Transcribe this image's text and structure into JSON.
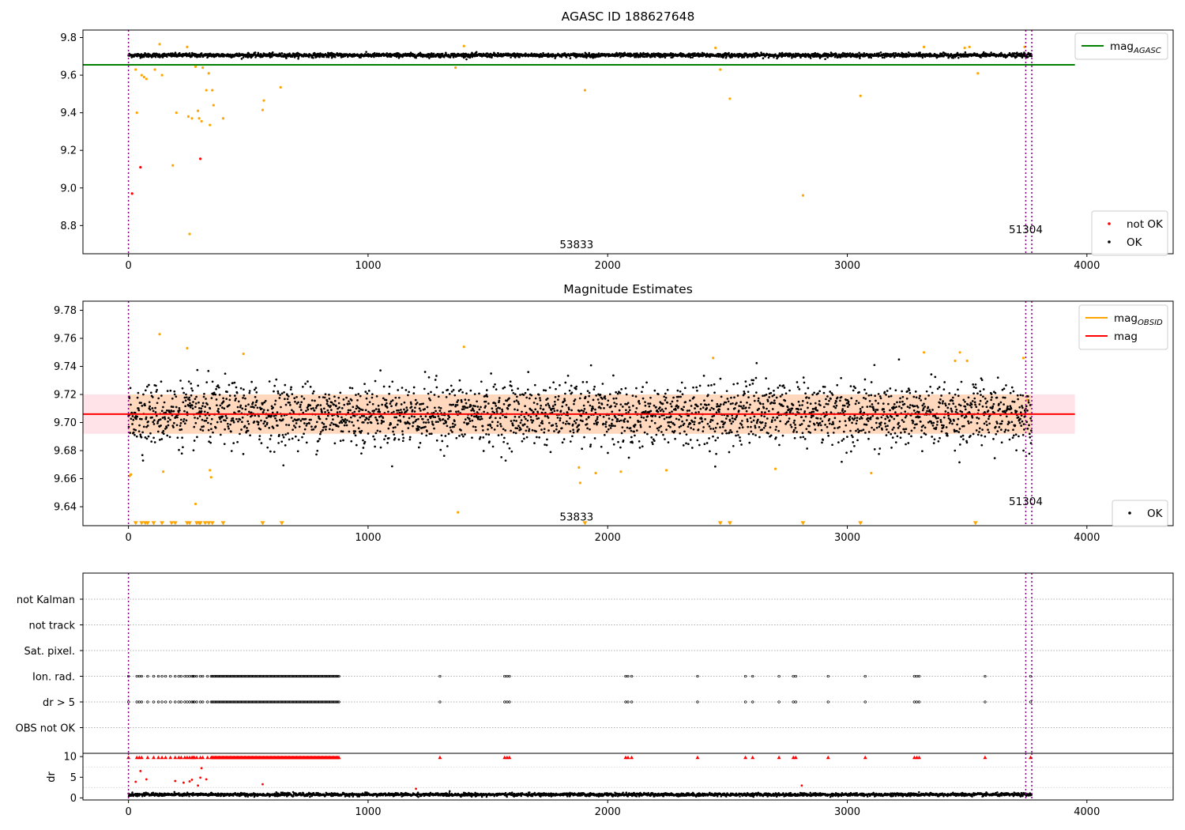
{
  "chart_data": [
    {
      "type": "scatter",
      "title": "AGASC ID 188627648",
      "xlim": [
        -190,
        4360
      ],
      "ylim": [
        8.65,
        9.84
      ],
      "xticks": [
        0,
        1000,
        2000,
        3000,
        4000
      ],
      "yticks": [
        8.8,
        9.0,
        9.2,
        9.4,
        9.6,
        9.8
      ],
      "ytick_labels": [
        "8.8",
        "9.0",
        "9.2",
        "9.4",
        "9.6",
        "9.8"
      ],
      "vlines": [
        0,
        3745,
        3770
      ],
      "hline": {
        "label": "mag_AGASC",
        "y": 9.655,
        "x_range": [
          -190,
          3950
        ],
        "color": "#008000"
      },
      "annotations": [
        {
          "text": "53833",
          "x": 1870,
          "y": 8.7
        },
        {
          "text": "51304",
          "x": 3745,
          "y": 8.78
        }
      ],
      "legend_upper": [
        {
          "label": "mag",
          "sub": "AGASC",
          "style": "line",
          "color": "#008000"
        }
      ],
      "legend_lower": [
        {
          "label": "not OK",
          "style": "point",
          "color": "#ff0000"
        },
        {
          "label": "OK",
          "style": "point",
          "color": "#000000"
        }
      ],
      "dense_band": {
        "x_range": [
          0,
          3770
        ],
        "center": 9.706,
        "half_width": 0.012,
        "color": "#000000"
      },
      "series": [
        {
          "name": "not OK",
          "color": "#ff0000",
          "points": [
            [
              15,
              8.97
            ],
            [
              50,
              9.11
            ],
            [
              300,
              9.155
            ]
          ]
        },
        {
          "color": "#ffa500",
          "points": [
            [
              30,
              9.63
            ],
            [
              35,
              9.4
            ],
            [
              55,
              9.6
            ],
            [
              65,
              9.59
            ],
            [
              75,
              9.58
            ],
            [
              110,
              9.63
            ],
            [
              130,
              9.765
            ],
            [
              140,
              9.6
            ],
            [
              185,
              9.12
            ],
            [
              200,
              9.4
            ],
            [
              245,
              9.75
            ],
            [
              250,
              9.38
            ],
            [
              255,
              8.755
            ],
            [
              265,
              9.37
            ],
            [
              280,
              9.645
            ],
            [
              290,
              9.41
            ],
            [
              295,
              9.37
            ],
            [
              305,
              9.355
            ],
            [
              310,
              9.64
            ],
            [
              325,
              9.52
            ],
            [
              335,
              9.61
            ],
            [
              340,
              9.335
            ],
            [
              350,
              9.52
            ],
            [
              355,
              9.44
            ],
            [
              395,
              9.37
            ],
            [
              560,
              9.415
            ],
            [
              565,
              9.465
            ],
            [
              635,
              9.535
            ],
            [
              1365,
              9.64
            ],
            [
              1400,
              9.755
            ],
            [
              1905,
              9.52
            ],
            [
              2450,
              9.745
            ],
            [
              2470,
              9.63
            ],
            [
              2510,
              9.475
            ],
            [
              2815,
              8.96
            ],
            [
              3055,
              9.49
            ],
            [
              3320,
              9.75
            ],
            [
              3490,
              9.745
            ],
            [
              3510,
              9.75
            ],
            [
              3545,
              9.61
            ],
            [
              3740,
              9.75
            ]
          ]
        }
      ]
    },
    {
      "type": "scatter",
      "title": "Magnitude Estimates",
      "xlim": [
        -190,
        4360
      ],
      "ylim": [
        9.6265,
        9.7865
      ],
      "xticks": [
        0,
        1000,
        2000,
        3000,
        4000
      ],
      "yticks": [
        9.64,
        9.66,
        9.68,
        9.7,
        9.72,
        9.74,
        9.76,
        9.78
      ],
      "ytick_labels": [
        "9.64",
        "9.66",
        "9.68",
        "9.70",
        "9.72",
        "9.74",
        "9.76",
        "9.78"
      ],
      "vlines": [
        0,
        3745,
        3770
      ],
      "mag_line": {
        "label": "mag",
        "y": 9.706,
        "x_range": [
          -190,
          3950
        ],
        "color": "#ff0000"
      },
      "mag_band": {
        "y_range": [
          9.692,
          9.72
        ],
        "x_range": [
          -190,
          3950
        ],
        "color": "#ffc0cb"
      },
      "obsid_band": {
        "y_range": [
          9.692,
          9.72
        ],
        "x_range": [
          0,
          3770
        ],
        "color": "#ffa500"
      },
      "annotations": [
        {
          "text": "53833",
          "x": 1870,
          "y": 9.633
        },
        {
          "text": "51304",
          "x": 3745,
          "y": 9.644
        }
      ],
      "legend_upper": [
        {
          "label": "mag",
          "sub": "OBSID",
          "style": "line",
          "color": "#ffa500"
        },
        {
          "label": "mag",
          "style": "line",
          "color": "#ff0000"
        }
      ],
      "legend_lower": [
        {
          "label": "OK",
          "style": "point",
          "color": "#000000"
        }
      ],
      "dense_scatter": {
        "x_range": [
          0,
          3770
        ],
        "center": 9.706,
        "spread": 0.011,
        "color": "#000000"
      },
      "series": [
        {
          "color": "#ffa500",
          "points": [
            [
              5,
              9.662
            ],
            [
              10,
              9.663
            ],
            [
              130,
              9.763
            ],
            [
              145,
              9.665
            ],
            [
              245,
              9.753
            ],
            [
              280,
              9.642
            ],
            [
              340,
              9.666
            ],
            [
              345,
              9.661
            ],
            [
              480,
              9.749
            ],
            [
              1375,
              9.636
            ],
            [
              1400,
              9.754
            ],
            [
              1880,
              9.668
            ],
            [
              1885,
              9.657
            ],
            [
              1950,
              9.664
            ],
            [
              2055,
              9.665
            ],
            [
              2245,
              9.666
            ],
            [
              2440,
              9.746
            ],
            [
              2700,
              9.667
            ],
            [
              3100,
              9.664
            ],
            [
              3320,
              9.75
            ],
            [
              3450,
              9.744
            ],
            [
              3470,
              9.75
            ],
            [
              3500,
              9.744
            ],
            [
              3735,
              9.746
            ],
            [
              3750,
              9.716
            ]
          ]
        },
        {
          "color": "#ffa500",
          "marker": "triangle-down",
          "y_edge": 9.628,
          "points_x": [
            30,
            55,
            70,
            80,
            105,
            140,
            180,
            195,
            245,
            255,
            285,
            295,
            300,
            320,
            335,
            350,
            395,
            560,
            640,
            1905,
            2470,
            2510,
            2815,
            3055,
            3535
          ]
        }
      ]
    },
    {
      "type": "event",
      "xlim": [
        -190,
        4360
      ],
      "xticks": [
        0,
        1000,
        2000,
        3000,
        4000
      ],
      "vlines": [
        0,
        3745,
        3770
      ],
      "categories": [
        "not Kalman",
        "not track",
        "Sat. pixel.",
        "Ion. rad.",
        "dr > 5",
        "OBS not OK"
      ],
      "event_rows": [
        {
          "category": "Ion. rad.",
          "x": [
            0,
            35,
            45,
            55,
            80,
            105,
            125,
            140,
            155,
            175,
            195,
            210,
            220,
            235,
            245,
            255,
            265,
            270,
            275,
            285,
            300,
            310,
            330,
            1300,
            1570,
            1580,
            1590,
            2075,
            2085,
            2100,
            2375,
            2575,
            2605,
            2715,
            2775,
            2785,
            2920,
            3075,
            3280,
            3290,
            3300,
            3575,
            3765
          ]
        },
        {
          "category": "dr > 5",
          "x": [
            0,
            35,
            45,
            55,
            80,
            105,
            125,
            140,
            155,
            175,
            195,
            210,
            220,
            235,
            245,
            255,
            265,
            270,
            275,
            285,
            300,
            310,
            330,
            1300,
            1570,
            1580,
            1590,
            2075,
            2085,
            2100,
            2375,
            2575,
            2605,
            2715,
            2775,
            2785,
            2920,
            3075,
            3280,
            3290,
            3300,
            3575,
            3765
          ]
        }
      ],
      "dense_ranges": [
        {
          "category": "Ion. rad.",
          "x_range": [
            345,
            880
          ]
        },
        {
          "category": "dr > 5",
          "x_range": [
            345,
            880
          ]
        }
      ]
    },
    {
      "type": "scatter",
      "ylabel": "dr",
      "xlim": [
        -190,
        4360
      ],
      "ylim": [
        -0.5,
        10.8
      ],
      "xticks": [
        0,
        1000,
        2000,
        3000,
        4000
      ],
      "yticks": [
        0,
        5,
        10
      ],
      "ytick_labels": [
        "0",
        "5",
        "10"
      ],
      "vlines": [
        0,
        3745,
        3770
      ],
      "dense_band": {
        "x_range": [
          0,
          3770
        ],
        "center": 0.8,
        "half_width": 0.35,
        "color": "#000000"
      },
      "series": [
        {
          "color": "#ff0000",
          "y_value": 9.8,
          "marker": "triangle-up",
          "points_x": [
            0,
            35,
            45,
            55,
            80,
            105,
            125,
            140,
            155,
            175,
            195,
            210,
            220,
            235,
            245,
            255,
            265,
            270,
            275,
            285,
            300,
            310,
            330,
            1300,
            1570,
            1580,
            1590,
            2075,
            2085,
            2100,
            2375,
            2575,
            2605,
            2715,
            2775,
            2785,
            2920,
            3075,
            3280,
            3290,
            3300,
            3575,
            3765
          ]
        },
        {
          "color": "#ff0000",
          "dense_range_x": [
            345,
            880
          ],
          "y_value": 9.8
        },
        {
          "color": "#ff0000",
          "points": [
            [
              30,
              3.9
            ],
            [
              50,
              6.5
            ],
            [
              75,
              4.5
            ],
            [
              195,
              4.1
            ],
            [
              230,
              3.7
            ],
            [
              255,
              4.0
            ],
            [
              265,
              4.4
            ],
            [
              290,
              3.0
            ],
            [
              305,
              7.2
            ],
            [
              300,
              4.9
            ],
            [
              325,
              4.5
            ],
            [
              560,
              3.3
            ],
            [
              2810,
              3.0
            ],
            [
              1200,
              2.2
            ]
          ]
        }
      ]
    }
  ]
}
